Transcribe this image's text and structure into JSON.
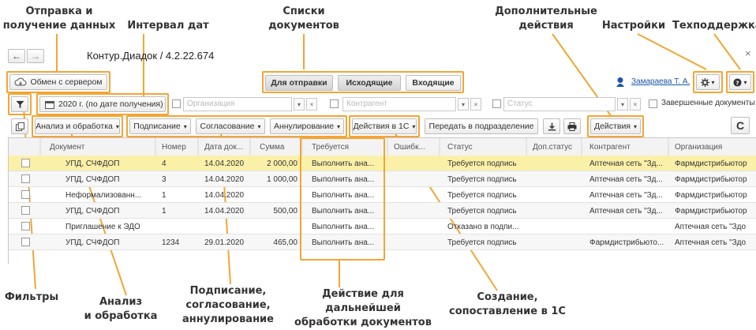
{
  "callouts": {
    "sync": "Отправка и\nполучение данных",
    "date_interval": "Интервал дат",
    "doc_lists": "Списки\nдокументов",
    "extra_actions": "Дополнительные\nдействия",
    "settings": "Настройки",
    "support": "Техподдержка",
    "filters": "Фильтры",
    "analysis": "Анализ\nи обработка",
    "signing": "Подписание,\nсогласование,\nаннулирование",
    "further_action": "Действие для дальнейшей\nобработки документов",
    "create_1c": "Создание,\nсопоставление в 1С"
  },
  "window": {
    "back": "←",
    "forward": "→",
    "title": "Контур.Диадок / 4.2.22.674",
    "close": "×"
  },
  "toolbar1": {
    "exchange_button": "Обмен с сервером",
    "tab_outgoing_to_send": "Для отправки",
    "tab_outgoing": "Исходящие",
    "tab_incoming": "Входящие",
    "user_name": "Замараева Т. А.",
    "settings_caret": "▾",
    "help_caret": "▾"
  },
  "filters": {
    "date_filter": "2020 г. (по дате получения)",
    "organization_placeholder": "Организация",
    "counterparty_placeholder": "Контрагент",
    "status_placeholder": "Статус",
    "completed_docs_label": "Завершенные документы"
  },
  "toolbar2": {
    "analysis": "Анализ и обработка",
    "signing": "Подписание",
    "approval": "Согласование",
    "cancellation": "Аннулирование",
    "actions_1c": "Действия в 1С",
    "transfer": "Передать в подразделение",
    "actions": "Действия",
    "refresh": "C"
  },
  "table": {
    "columns": [
      "Документ",
      "Номер",
      "Дата док...",
      "Сумма",
      "Требуется",
      "Ошибк...",
      "Статус",
      "Доп.статус",
      "Контрагент",
      "Организация"
    ],
    "rows": [
      {
        "doc": "УПД, СЧФДОП",
        "num": "4",
        "date": "14.04.2020",
        "sum": "2 000,00",
        "req": "Выполнить ана...",
        "err": "",
        "status": "Требуется подпись",
        "extra": "",
        "counterparty": "Аптечная сеть \"Зд...",
        "org": "Фармдистрибьютор"
      },
      {
        "doc": "УПД, СЧФДОП",
        "num": "3",
        "date": "14.04.2020",
        "sum": "1 000,00",
        "req": "Выполнить ана...",
        "err": "",
        "status": "Требуется подпись",
        "extra": "",
        "counterparty": "Аптечная сеть \"Зд...",
        "org": "Фармдистрибьютор"
      },
      {
        "doc": "Неформализованн...",
        "num": "1",
        "date": "14.04.2020",
        "sum": "",
        "req": "Выполнить ана...",
        "err": "",
        "status": "Требуется подпись",
        "extra": "",
        "counterparty": "Аптечная сеть \"Зд...",
        "org": "Фармдистрибьютор"
      },
      {
        "doc": "УПД, СЧФДОП",
        "num": "1",
        "date": "14.04.2020",
        "sum": "500,00",
        "req": "Выполнить ана...",
        "err": "",
        "status": "Требуется подпись",
        "extra": "",
        "counterparty": "Аптечная сеть \"Зд...",
        "org": "Фармдистрибьютор"
      },
      {
        "doc": "Приглашение к ЭДО",
        "num": "",
        "date": "",
        "sum": "",
        "req": "Выполнить ана...",
        "err": "",
        "status": "Отказано в подпи...",
        "extra": "",
        "counterparty": "",
        "org": "Аптечная сеть \"Здо"
      },
      {
        "doc": "УПД, СЧФДОП",
        "num": "1234",
        "date": "29.01.2020",
        "sum": "465,00",
        "req": "Выполнить ана...",
        "err": "",
        "status": "Требуется подпись",
        "extra": "",
        "counterparty": "Фармдистрибьюто...",
        "org": "Аптечная сеть \"Здо"
      }
    ]
  },
  "colors": {
    "highlight": "#f4a533",
    "selected_row": "#fbf0a8",
    "link": "#1a56a8"
  }
}
